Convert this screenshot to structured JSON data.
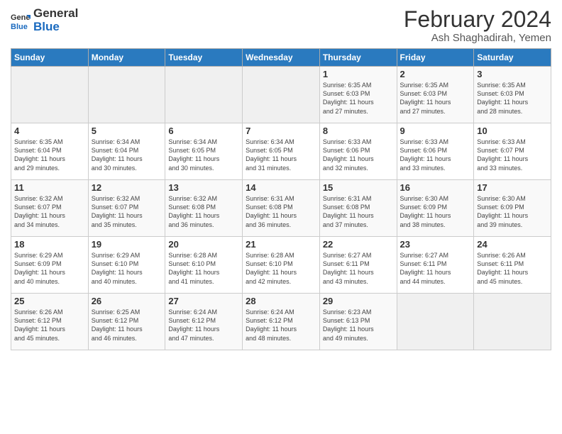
{
  "logo": {
    "general": "General",
    "blue": "Blue"
  },
  "title": "February 2024",
  "subtitle": "Ash Shaghadirah, Yemen",
  "days_header": [
    "Sunday",
    "Monday",
    "Tuesday",
    "Wednesday",
    "Thursday",
    "Friday",
    "Saturday"
  ],
  "weeks": [
    [
      {
        "num": "",
        "info": ""
      },
      {
        "num": "",
        "info": ""
      },
      {
        "num": "",
        "info": ""
      },
      {
        "num": "",
        "info": ""
      },
      {
        "num": "1",
        "info": "Sunrise: 6:35 AM\nSunset: 6:03 PM\nDaylight: 11 hours\nand 27 minutes."
      },
      {
        "num": "2",
        "info": "Sunrise: 6:35 AM\nSunset: 6:03 PM\nDaylight: 11 hours\nand 27 minutes."
      },
      {
        "num": "3",
        "info": "Sunrise: 6:35 AM\nSunset: 6:03 PM\nDaylight: 11 hours\nand 28 minutes."
      }
    ],
    [
      {
        "num": "4",
        "info": "Sunrise: 6:35 AM\nSunset: 6:04 PM\nDaylight: 11 hours\nand 29 minutes."
      },
      {
        "num": "5",
        "info": "Sunrise: 6:34 AM\nSunset: 6:04 PM\nDaylight: 11 hours\nand 30 minutes."
      },
      {
        "num": "6",
        "info": "Sunrise: 6:34 AM\nSunset: 6:05 PM\nDaylight: 11 hours\nand 30 minutes."
      },
      {
        "num": "7",
        "info": "Sunrise: 6:34 AM\nSunset: 6:05 PM\nDaylight: 11 hours\nand 31 minutes."
      },
      {
        "num": "8",
        "info": "Sunrise: 6:33 AM\nSunset: 6:06 PM\nDaylight: 11 hours\nand 32 minutes."
      },
      {
        "num": "9",
        "info": "Sunrise: 6:33 AM\nSunset: 6:06 PM\nDaylight: 11 hours\nand 33 minutes."
      },
      {
        "num": "10",
        "info": "Sunrise: 6:33 AM\nSunset: 6:07 PM\nDaylight: 11 hours\nand 33 minutes."
      }
    ],
    [
      {
        "num": "11",
        "info": "Sunrise: 6:32 AM\nSunset: 6:07 PM\nDaylight: 11 hours\nand 34 minutes."
      },
      {
        "num": "12",
        "info": "Sunrise: 6:32 AM\nSunset: 6:07 PM\nDaylight: 11 hours\nand 35 minutes."
      },
      {
        "num": "13",
        "info": "Sunrise: 6:32 AM\nSunset: 6:08 PM\nDaylight: 11 hours\nand 36 minutes."
      },
      {
        "num": "14",
        "info": "Sunrise: 6:31 AM\nSunset: 6:08 PM\nDaylight: 11 hours\nand 36 minutes."
      },
      {
        "num": "15",
        "info": "Sunrise: 6:31 AM\nSunset: 6:08 PM\nDaylight: 11 hours\nand 37 minutes."
      },
      {
        "num": "16",
        "info": "Sunrise: 6:30 AM\nSunset: 6:09 PM\nDaylight: 11 hours\nand 38 minutes."
      },
      {
        "num": "17",
        "info": "Sunrise: 6:30 AM\nSunset: 6:09 PM\nDaylight: 11 hours\nand 39 minutes."
      }
    ],
    [
      {
        "num": "18",
        "info": "Sunrise: 6:29 AM\nSunset: 6:09 PM\nDaylight: 11 hours\nand 40 minutes."
      },
      {
        "num": "19",
        "info": "Sunrise: 6:29 AM\nSunset: 6:10 PM\nDaylight: 11 hours\nand 40 minutes."
      },
      {
        "num": "20",
        "info": "Sunrise: 6:28 AM\nSunset: 6:10 PM\nDaylight: 11 hours\nand 41 minutes."
      },
      {
        "num": "21",
        "info": "Sunrise: 6:28 AM\nSunset: 6:10 PM\nDaylight: 11 hours\nand 42 minutes."
      },
      {
        "num": "22",
        "info": "Sunrise: 6:27 AM\nSunset: 6:11 PM\nDaylight: 11 hours\nand 43 minutes."
      },
      {
        "num": "23",
        "info": "Sunrise: 6:27 AM\nSunset: 6:11 PM\nDaylight: 11 hours\nand 44 minutes."
      },
      {
        "num": "24",
        "info": "Sunrise: 6:26 AM\nSunset: 6:11 PM\nDaylight: 11 hours\nand 45 minutes."
      }
    ],
    [
      {
        "num": "25",
        "info": "Sunrise: 6:26 AM\nSunset: 6:12 PM\nDaylight: 11 hours\nand 45 minutes."
      },
      {
        "num": "26",
        "info": "Sunrise: 6:25 AM\nSunset: 6:12 PM\nDaylight: 11 hours\nand 46 minutes."
      },
      {
        "num": "27",
        "info": "Sunrise: 6:24 AM\nSunset: 6:12 PM\nDaylight: 11 hours\nand 47 minutes."
      },
      {
        "num": "28",
        "info": "Sunrise: 6:24 AM\nSunset: 6:12 PM\nDaylight: 11 hours\nand 48 minutes."
      },
      {
        "num": "29",
        "info": "Sunrise: 6:23 AM\nSunset: 6:13 PM\nDaylight: 11 hours\nand 49 minutes."
      },
      {
        "num": "",
        "info": ""
      },
      {
        "num": "",
        "info": ""
      }
    ]
  ]
}
